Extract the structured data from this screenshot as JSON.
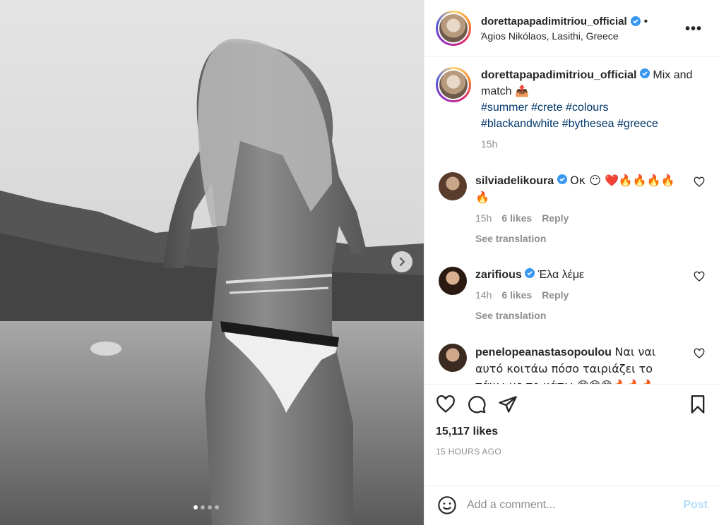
{
  "post": {
    "username": "dorettapapadimitriou_official",
    "location": "Άgios Nikólaos, Lasithi, Greece",
    "follow_dot": "•",
    "more_label": "•••"
  },
  "caption": {
    "username": "dorettapapadimitriou_official",
    "text": "Mix and match 📤",
    "hashtags_line1": "#summer #crete #colours",
    "hashtags_line2": "#blackandwhite #bythesea #greece",
    "time": "15h"
  },
  "comments": [
    {
      "username": "silviadelikoura",
      "text": "Οκ 😶 ❤️🔥🔥🔥🔥🔥",
      "time": "15h",
      "likes": "6 likes",
      "reply": "Reply",
      "see_translation": "See translation"
    },
    {
      "username": "zarifious",
      "text": "Έλα λέμε",
      "time": "14h",
      "likes": "6 likes",
      "reply": "Reply",
      "see_translation": "See translation"
    },
    {
      "username": "penelopeanastasopoulou",
      "text": "Ναι ναι αυτό κοιτάω πόσο ταιριάζει το πάνω με το κάτω 😊😊😊🔥🔥🔥"
    }
  ],
  "stats": {
    "likes": "15,117 likes",
    "time_ago": "15 HOURS AGO"
  },
  "add_comment": {
    "placeholder": "Add a comment...",
    "post_label": "Post"
  },
  "carousel": {
    "current_index": 1,
    "total": 4
  },
  "colors": {
    "hashtag": "#00376b",
    "verified": "#3897f0",
    "post_button": "#b2dffc",
    "muted": "#8e8e8e"
  }
}
